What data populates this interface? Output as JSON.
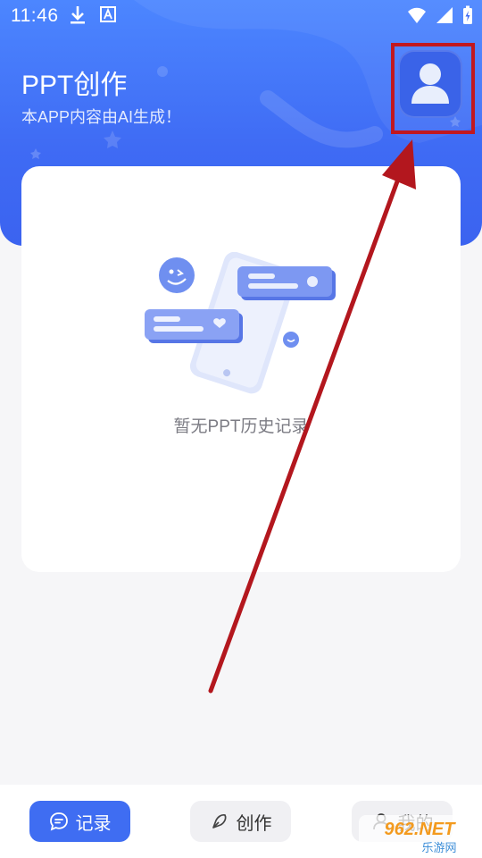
{
  "status_bar": {
    "time": "11:46",
    "icons_left": [
      "download-icon",
      "a-letter-icon"
    ],
    "icons_right": [
      "wifi-icon",
      "cellular-icon",
      "battery-charging-icon"
    ]
  },
  "header": {
    "title": "PPT创作",
    "subtitle": "本APP内容由AI生成！",
    "avatar_icon": "user-avatar-icon"
  },
  "content": {
    "empty_text": "暂无PPT历史记录",
    "illustration_icon": "phone-chat-illustration"
  },
  "bottom_nav": {
    "items": [
      {
        "label": "记录",
        "icon": "chat-bubble-icon",
        "active": true
      },
      {
        "label": "创作",
        "icon": "pen-nib-icon",
        "active": false
      },
      {
        "label": "我的",
        "icon": "profile-icon",
        "active": false
      }
    ]
  },
  "watermark": {
    "text": "962.NET",
    "subtext": "乐游网"
  },
  "colors": {
    "header": "#3f6bf4",
    "accent": "#3f6df2",
    "annotation": "#c1181f",
    "background": "#f6f6f8"
  }
}
